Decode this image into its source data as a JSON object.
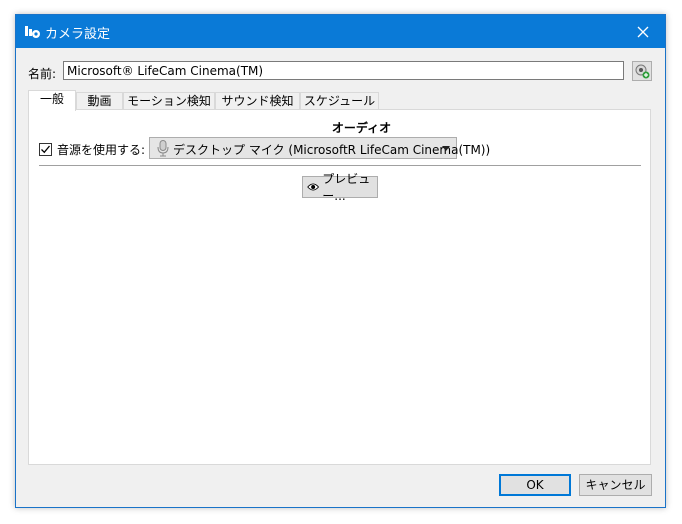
{
  "window": {
    "title": "カメラ設定",
    "icons": {
      "app": "camera-settings-icon",
      "close": "close-icon"
    }
  },
  "name_row": {
    "label": "名前:",
    "value": "Microsoft® LifeCam Cinema(TM)",
    "button_icon": "camera-add-icon"
  },
  "tabs": [
    {
      "label": "一般",
      "active": true
    },
    {
      "label": "動画",
      "active": false
    },
    {
      "label": "モーション検知",
      "active": false
    },
    {
      "label": "サウンド検知",
      "active": false
    },
    {
      "label": "スケジュール",
      "active": false
    }
  ],
  "audio": {
    "section_title": "オーディオ",
    "use_source_label": "音源を使用する:",
    "use_source_checked": true,
    "device_selected": "デスクトップ マイク (MicrosoftR LifeCam Cinema(TM))",
    "device_icon": "microphone-icon",
    "preview_label": "プレビュー...",
    "preview_icon": "eye-icon"
  },
  "footer": {
    "ok_label": "OK",
    "cancel_label": "キャンセル"
  },
  "colors": {
    "titlebar": "#0a7ad7",
    "dialog_bg": "#f0f0f0",
    "default_button_border": "#0078d7"
  }
}
